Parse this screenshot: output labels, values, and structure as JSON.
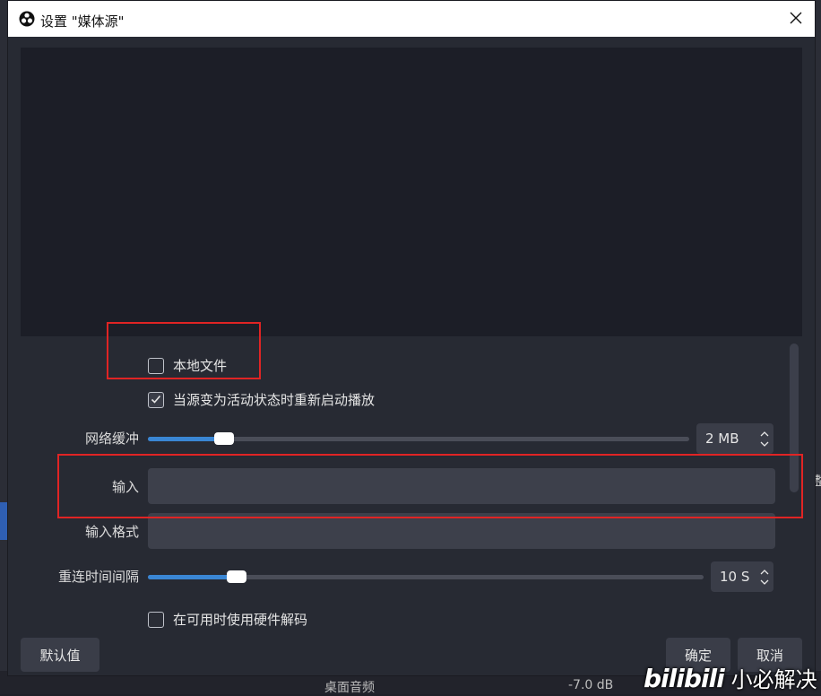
{
  "window": {
    "title": "设置 \"媒体源\""
  },
  "form": {
    "local_file": {
      "label": "本地文件",
      "checked": false
    },
    "restart_playback": {
      "label": "当源变为活动状态时重新启动播放",
      "checked": true
    },
    "network_buffer": {
      "label": "网络缓冲",
      "value": "2 MB",
      "slider_fraction": 0.14
    },
    "input": {
      "label": "输入",
      "value": "",
      "placeholder": ""
    },
    "input_format": {
      "label": "输入格式",
      "value": "",
      "placeholder": ""
    },
    "reconnect_delay": {
      "label": "重连时间间隔",
      "value": "10 S",
      "slider_fraction": 0.16
    },
    "hw_decode": {
      "label": "在可用时使用硬件解码",
      "checked": false
    }
  },
  "buttons": {
    "defaults": "默认值",
    "ok": "确定",
    "cancel": "取消"
  },
  "background": {
    "partial_char": "整",
    "bottom_text_1": "桌面音频",
    "bottom_text_2": "-7.0 dB"
  },
  "watermark": {
    "logo_text": "bilibili",
    "text": "小必解决"
  },
  "colors": {
    "highlight_red": "#e02424",
    "slider_blue": "#3a86d4",
    "dialog_bg": "#272a33",
    "preview_bg": "#1c1e27"
  },
  "icons": {
    "app_logo": "obs-logo-icon",
    "close": "close-icon",
    "checkbox_checked": "check-icon",
    "spin_up": "chevron-up-icon",
    "spin_down": "chevron-down-icon"
  }
}
